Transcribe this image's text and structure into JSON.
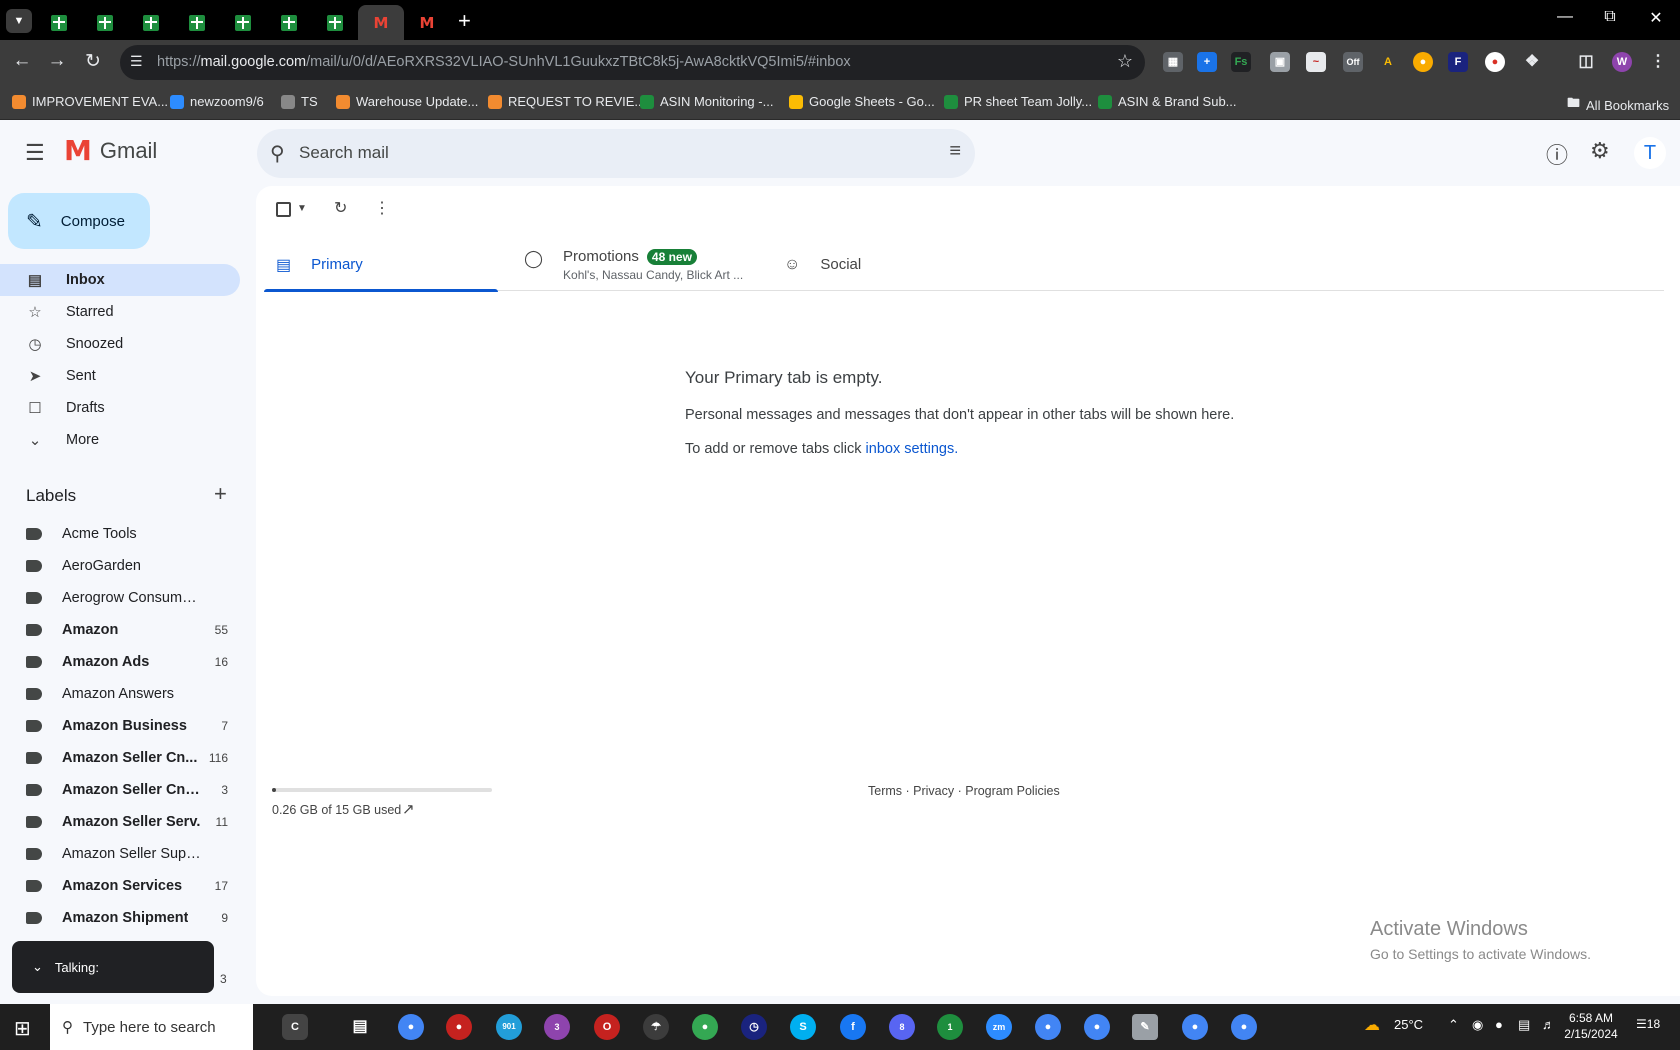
{
  "browser": {
    "url_prefix": "https://",
    "url_host": "mail.google.com",
    "url_path": "/mail/u/0/d/AEoRXRS32VLIAO-SUnhVL1GuukxzTBtC8k5j-AwA8cktkVQ5Imi5/#inbox",
    "bookmarks": [
      {
        "label": "IMPROVEMENT EVA...",
        "color": "#f28b30"
      },
      {
        "label": "newzoom9/6",
        "color": "#2d8cff"
      },
      {
        "label": "TS",
        "color": "#888888"
      },
      {
        "label": "Warehouse Update...",
        "color": "#f28b30"
      },
      {
        "label": "REQUEST TO REVIE...",
        "color": "#f28b30"
      },
      {
        "label": "ASIN Monitoring -...",
        "color": "#1e8e3e"
      },
      {
        "label": "Google Sheets - Go...",
        "color": "#fbbc04"
      },
      {
        "label": "PR sheet Team Jolly...",
        "color": "#1e8e3e"
      },
      {
        "label": "ASIN & Brand Sub...",
        "color": "#1e8e3e"
      }
    ],
    "all_bookmarks": "All Bookmarks",
    "profile_initial": "W",
    "ext_badge": "Off"
  },
  "gmail": {
    "app_name": "Gmail",
    "search_placeholder": "Search mail",
    "avatar_initial": "T",
    "compose_label": "Compose",
    "nav": [
      {
        "label": "Inbox",
        "icon": "inbox-icon"
      },
      {
        "label": "Starred",
        "icon": "star-icon"
      },
      {
        "label": "Snoozed",
        "icon": "clock-icon"
      },
      {
        "label": "Sent",
        "icon": "send-icon"
      },
      {
        "label": "Drafts",
        "icon": "draft-icon"
      },
      {
        "label": "More",
        "icon": "chevron-down-icon"
      }
    ],
    "labels_heading": "Labels",
    "labels": [
      {
        "name": "Acme Tools",
        "count": "",
        "bold": false
      },
      {
        "name": "AeroGarden",
        "count": "",
        "bold": false
      },
      {
        "name": "Aerogrow Consumer Se...",
        "count": "",
        "bold": false
      },
      {
        "name": "Amazon",
        "count": "55",
        "bold": true
      },
      {
        "name": "Amazon Ads",
        "count": "16",
        "bold": true
      },
      {
        "name": "Amazon Answers",
        "count": "",
        "bold": false
      },
      {
        "name": "Amazon Business",
        "count": "7",
        "bold": true
      },
      {
        "name": "Amazon Seller Cn...",
        "count": "116",
        "bold": true
      },
      {
        "name": "Amazon Seller Cntr...",
        "count": "3",
        "bold": true
      },
      {
        "name": "Amazon Seller Serv.",
        "count": "11",
        "bold": true
      },
      {
        "name": "Amazon Seller Support",
        "count": "",
        "bold": false
      },
      {
        "name": "Amazon Services",
        "count": "17",
        "bold": true
      },
      {
        "name": "Amazon Shipment",
        "count": "9",
        "bold": true
      }
    ],
    "partial_label_count": "3",
    "tabs": {
      "primary": "Primary",
      "promotions": "Promotions",
      "promotions_badge": "48 new",
      "promotions_sub": "Kohl's, Nassau Candy, Blick Art ...",
      "social": "Social"
    },
    "empty": {
      "title": "Your Primary tab is empty.",
      "message": "Personal messages and messages that don't appear in other tabs will be shown here.",
      "settings_prefix": "To add or remove tabs click ",
      "settings_link": "inbox settings."
    },
    "storage": {
      "text": "0.26 GB of 15 GB used",
      "fraction": 0.017
    },
    "footer": {
      "terms": "Terms",
      "privacy": "Privacy",
      "policies": "Program Policies",
      "sep": " · "
    },
    "talking": "Talking:"
  },
  "windows": {
    "activate_title": "Activate Windows",
    "activate_sub": "Go to Settings to activate Windows.",
    "search_placeholder": "Type here to search",
    "weather": "25°C",
    "time": "6:58 AM",
    "date": "2/15/2024",
    "notif_count": "18",
    "badge_telegram": "901",
    "badge_1": "3",
    "badge_2": "8",
    "badge_3": "1"
  }
}
